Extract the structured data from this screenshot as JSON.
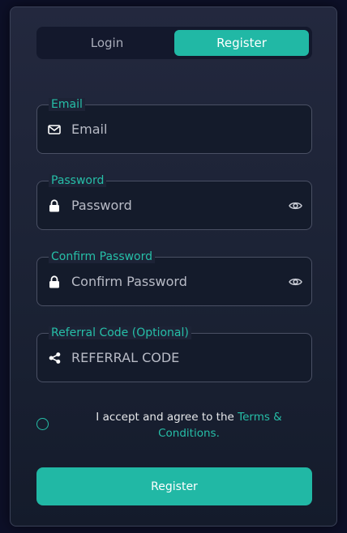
{
  "tabs": {
    "login": "Login",
    "register": "Register",
    "active": "register"
  },
  "fields": {
    "email": {
      "label": "Email",
      "placeholder": "Email",
      "value": ""
    },
    "password": {
      "label": "Password",
      "placeholder": "Password",
      "value": ""
    },
    "confirm_password": {
      "label": "Confirm Password",
      "placeholder": "Confirm Password",
      "value": ""
    },
    "referral": {
      "label": "Referral Code (Optional)",
      "placeholder": "REFERRAL CODE",
      "value": ""
    }
  },
  "terms": {
    "text": "I accept and agree to the ",
    "link": "Terms & Conditions."
  },
  "submit_label": "Register",
  "colors": {
    "accent": "#21b8a5",
    "label": "#26bfa8",
    "background": "#1b2234"
  },
  "icons": {
    "email": "envelope-icon",
    "password": "lock-icon",
    "confirm_password": "lock-icon",
    "referral": "share-icon",
    "toggle": "eye-icon"
  }
}
